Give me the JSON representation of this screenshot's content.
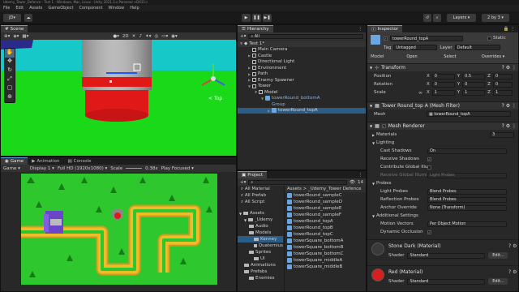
{
  "window": {
    "title": "Udemy_Tower_Defence - Test 1 - Windows, Mac, Linux - Unity 2021.3.x Personal <DX11>"
  },
  "menu": [
    "File",
    "Edit",
    "Assets",
    "GameObject",
    "Component",
    "Window",
    "Help"
  ],
  "toolbar": {
    "account": "JD",
    "layers": "Layers",
    "layout": "2 by 3",
    "play_icon": "play-icon",
    "pause_icon": "pause-icon",
    "step_icon": "step-icon"
  },
  "scene": {
    "tab": "Scene",
    "gizmo_label": "Top",
    "colors": {
      "sky": "#17c8c8",
      "ground": "#19d919",
      "tower_grey": "#b4b4b4",
      "tower_red": "#e01818"
    }
  },
  "game": {
    "tabs": [
      "Game",
      "Animation",
      "Console"
    ],
    "view": "Game",
    "display": "Display 1",
    "resolution": "Full HD (1920x1080)",
    "scale_label": "Scale",
    "scale": "0.38x",
    "play_focused": "Play Focused",
    "colors": {
      "grass": "#2ec82e",
      "path": "#f0bd2a",
      "path_edge": "#d49a1e"
    }
  },
  "hierarchy": {
    "tab": "Hierarchy",
    "search_placeholder": "All",
    "scene_name": "Test 1*",
    "items": [
      {
        "label": "Main Camera",
        "indent": 2
      },
      {
        "label": "Castle",
        "indent": 2
      },
      {
        "label": "Directional Light",
        "indent": 2
      },
      {
        "label": "Environment",
        "indent": 2
      },
      {
        "label": "Path",
        "indent": 2
      },
      {
        "label": "Enemy Spawner",
        "indent": 2
      },
      {
        "label": "Tower",
        "indent": 2
      },
      {
        "label": "Model",
        "indent": 3
      },
      {
        "label": "towerRound_bottomA",
        "indent": 4
      },
      {
        "label": "Group",
        "indent": 5
      },
      {
        "label": "towerRound_topA",
        "indent": 5
      }
    ]
  },
  "project": {
    "tab": "Project",
    "search_placeholder": "",
    "count": "14",
    "favorites": [
      "All Material",
      "All Prefab",
      "All Script"
    ],
    "breadcrumb": "Assets > _Udemy_Tower Defence",
    "tree": [
      {
        "label": "Assets",
        "indent": 0
      },
      {
        "label": "_Udemy",
        "indent": 1
      },
      {
        "label": "Audio",
        "indent": 2
      },
      {
        "label": "Models",
        "indent": 2
      },
      {
        "label": "Kenney",
        "indent": 3
      },
      {
        "label": "Quaternius",
        "indent": 3
      },
      {
        "label": "Sprites",
        "indent": 2
      },
      {
        "label": "UI",
        "indent": 3
      },
      {
        "label": "Animations",
        "indent": 1
      },
      {
        "label": "Prefabs",
        "indent": 1
      },
      {
        "label": "Enemies",
        "indent": 2
      }
    ],
    "files": [
      "towerRound_sampleC",
      "towerRound_sampleD",
      "towerRound_sampleE",
      "towerRound_sampleF",
      "towerRound_topA",
      "towerRound_topB",
      "towerRound_topC",
      "towerSquare_bottomA",
      "towerSquare_bottomB",
      "towerSquare_bottomC",
      "towerSquare_middleA",
      "towerSquare_middleB"
    ]
  },
  "inspector": {
    "tab": "Inspector",
    "object_name": "towerRound_topA",
    "static_label": "Static",
    "tag_label": "Tag",
    "tag": "Untagged",
    "layer_label": "Layer",
    "layer": "Default",
    "model_label": "Model",
    "open_btn": "Open",
    "select_btn": "Select",
    "overrides_btn": "Overrides",
    "transform": {
      "title": "Transform",
      "rows": [
        {
          "label": "Position",
          "x": "0",
          "y": "0.5",
          "z": "0"
        },
        {
          "label": "Rotation",
          "x": "0",
          "y": "0",
          "z": "0"
        },
        {
          "label": "Scale",
          "x": "1",
          "y": "1",
          "z": "1"
        }
      ]
    },
    "mesh_filter": {
      "title": "Tower Round_top A (Mesh Filter)",
      "mesh_label": "Mesh",
      "mesh": "towerRound_topA"
    },
    "mesh_renderer": {
      "title": "Mesh Renderer",
      "materials_label": "Materials",
      "materials_count": "3",
      "lighting_label": "Lighting",
      "cast_shadows_label": "Cast Shadows",
      "cast_shadows": "On",
      "receive_shadows_label": "Receive Shadows",
      "contribute_gi_label": "Contribute Global Illumination",
      "receive_gi_label": "Receive Global Illumination",
      "receive_gi": "Light Probes",
      "probes_label": "Probes",
      "light_probes_label": "Light Probes",
      "light_probes": "Blend Probes",
      "reflection_probes_label": "Reflection Probes",
      "reflection_probes": "Blend Probes",
      "anchor_override_label": "Anchor Override",
      "anchor_override": "None (Transform)",
      "additional_label": "Additional Settings",
      "motion_vectors_label": "Motion Vectors",
      "motion_vectors": "Per Object Motion",
      "dynamic_occlusion_label": "Dynamic Occlusion"
    },
    "materials": [
      {
        "title": "Stone Dark (Material)",
        "shader_label": "Shader",
        "shader": "Standard",
        "edit": "Edit...",
        "color": "#3a3a3a"
      },
      {
        "title": "Red (Material)",
        "shader_label": "Shader",
        "shader": "Standard",
        "edit": "Edit...",
        "color": "#d62020"
      }
    ]
  }
}
